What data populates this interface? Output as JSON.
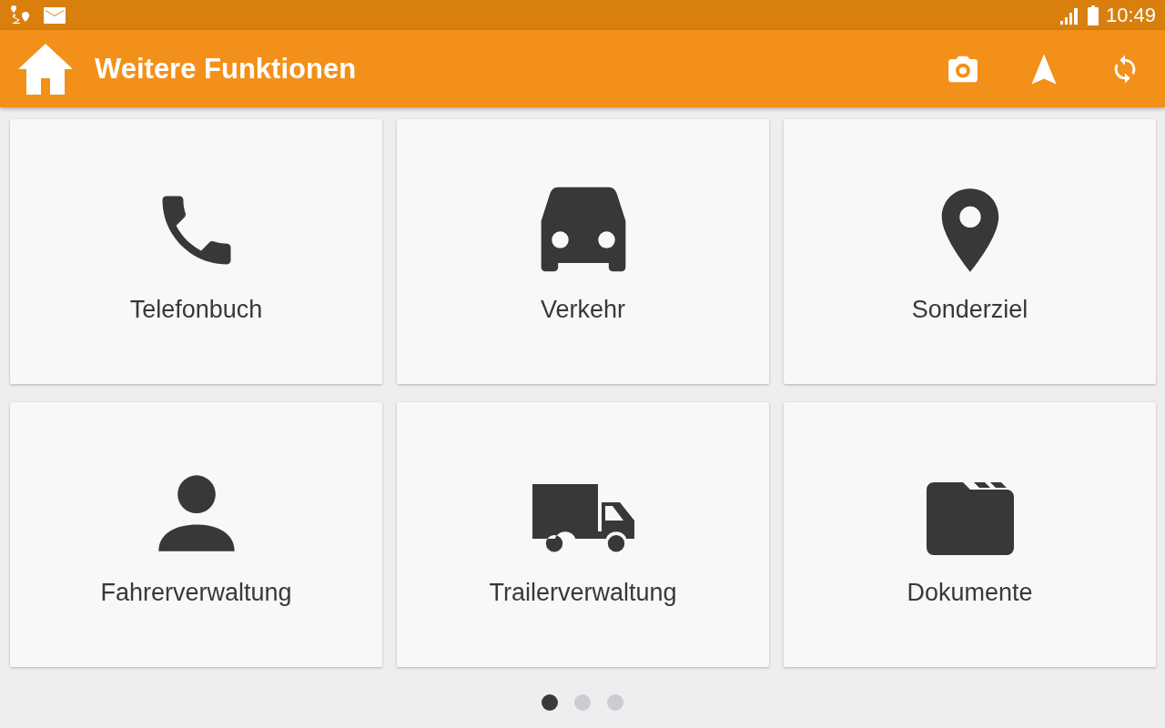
{
  "status_bar": {
    "time": "10:49"
  },
  "app_bar": {
    "title": "Weitere Funktionen"
  },
  "tiles": [
    {
      "kind": "phone",
      "label": "Telefonbuch"
    },
    {
      "kind": "car",
      "label": "Verkehr"
    },
    {
      "kind": "pin",
      "label": "Sonderziel"
    },
    {
      "kind": "person",
      "label": "Fahrerverwaltung"
    },
    {
      "kind": "truck",
      "label": "Trailerverwaltung"
    },
    {
      "kind": "folder",
      "label": "Dokumente"
    }
  ],
  "pages": [
    {
      "selected": true
    },
    {
      "selected": false
    },
    {
      "selected": false
    }
  ]
}
